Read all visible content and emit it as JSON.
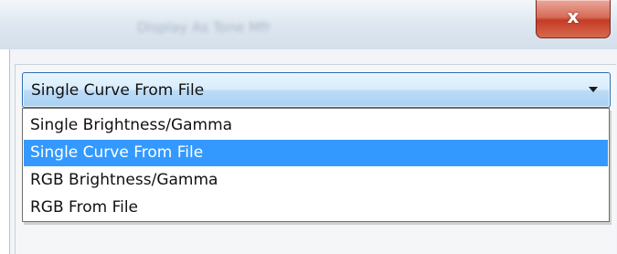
{
  "window": {
    "title": "Display As    Tone Mfr",
    "close_glyph": "x"
  },
  "combo": {
    "selected_value": "Single Curve From File",
    "arrow_icon": "chevron-down-icon"
  },
  "dropdown": {
    "options": [
      "Single Brightness/Gamma",
      "Single Curve From File",
      "RGB Brightness/Gamma",
      "RGB From File"
    ],
    "selected_index": 1
  },
  "colors": {
    "selection": "#3399ff",
    "combo_border": "#2f6fb4",
    "close_red": "#c53b25"
  }
}
